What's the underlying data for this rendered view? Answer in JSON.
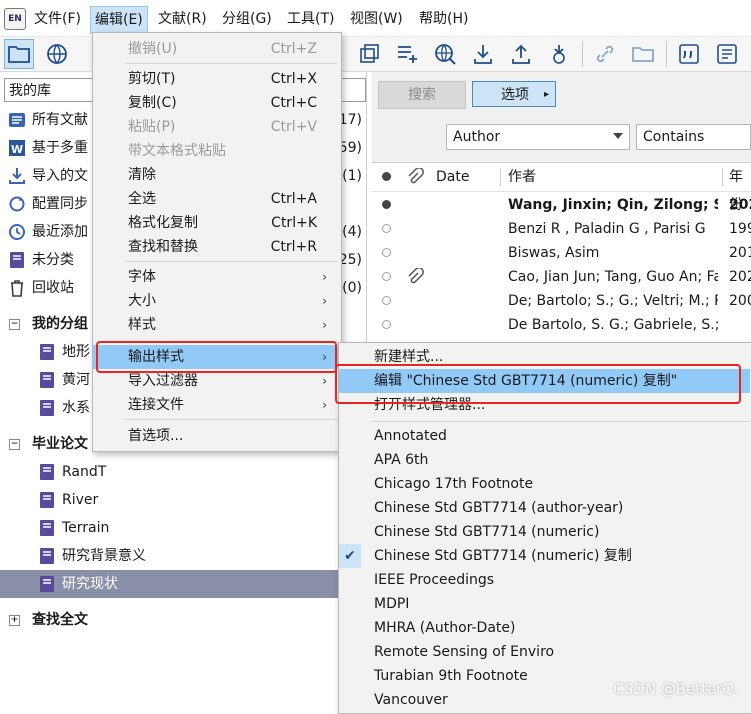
{
  "app": {
    "logo": "EN"
  },
  "menubar": [
    "文件(F)",
    "编辑(E)",
    "文献(R)",
    "分组(G)",
    "工具(T)",
    "视图(W)",
    "帮助(H)"
  ],
  "left": {
    "library_label": "我的库",
    "items": [
      {
        "label": "所有文献",
        "count": "17)",
        "icon": "all-refs-icon"
      },
      {
        "label": "基于多重",
        "count": "59)",
        "icon": "word-doc-icon"
      },
      {
        "label": "导入的文",
        "count": "(1)",
        "icon": "import-icon"
      },
      {
        "label": "配置同步",
        "count": "",
        "icon": "sync-icon"
      },
      {
        "label": "最近添加",
        "count": "(4)",
        "icon": "recent-icon"
      },
      {
        "label": "未分类",
        "count": "25)",
        "icon": "group-icon"
      },
      {
        "label": "回收站",
        "count": "(0)",
        "icon": "trash-icon"
      }
    ],
    "group_sets": [
      {
        "label": "我的分组",
        "groups": [
          "地形",
          "黄河",
          "水系"
        ]
      },
      {
        "label": "毕业论文",
        "groups": [
          "RandT",
          "River",
          "Terrain",
          "研究背景意义",
          "研究现状"
        ]
      }
    ],
    "find_fulltext": "查找全文"
  },
  "right": {
    "search_btn": "搜索",
    "options_btn": "选项",
    "field_select": "Author",
    "op_select": "Contains",
    "col_date": "Date",
    "col_author": "作者",
    "col_year": "年份",
    "rows": [
      {
        "author": "Wang, Jinxin; Qin, Zilong; S...",
        "year": "202",
        "bold": true,
        "filled": true,
        "clip": false
      },
      {
        "author": "Benzi R , Paladin G , Parisi G",
        "year": "199",
        "bold": false,
        "filled": false,
        "clip": false
      },
      {
        "author": "Biswas, Asim",
        "year": "201",
        "bold": false,
        "filled": false,
        "clip": false
      },
      {
        "author": "Cao, Jian Jun; Tang, Guo An; Fa...",
        "year": "202",
        "bold": false,
        "filled": false,
        "clip": true
      },
      {
        "author": "De; Bartolo; S.; G.; Veltri; M.; Pr...",
        "year": "200",
        "bold": false,
        "filled": false,
        "clip": false
      },
      {
        "author": "De Bartolo, S. G.; Gabriele, S.; ...",
        "year": "",
        "bold": false,
        "filled": false,
        "clip": false
      }
    ]
  },
  "edit_menu": {
    "items": [
      {
        "label": "撤销(U)",
        "shortcut": "Ctrl+Z",
        "disabled": true
      },
      {
        "label": "剪切(T)",
        "shortcut": "Ctrl+X",
        "disabled": false
      },
      {
        "label": "复制(C)",
        "shortcut": "Ctrl+C",
        "disabled": false
      },
      {
        "label": "粘贴(P)",
        "shortcut": "Ctrl+V",
        "disabled": true
      },
      {
        "label": "带文本格式粘贴",
        "shortcut": "",
        "disabled": true
      },
      {
        "label": "清除",
        "shortcut": "",
        "disabled": false
      },
      {
        "label": "全选",
        "shortcut": "Ctrl+A",
        "disabled": false
      },
      {
        "label": "格式化复制",
        "shortcut": "Ctrl+K",
        "disabled": false
      },
      {
        "label": "查找和替换",
        "shortcut": "Ctrl+R",
        "disabled": false
      },
      {
        "label": "字体",
        "submenu": true
      },
      {
        "label": "大小",
        "submenu": true
      },
      {
        "label": "样式",
        "submenu": true
      },
      {
        "label": "输出样式",
        "submenu": true,
        "highlighted": true
      },
      {
        "label": "导入过滤器",
        "submenu": true
      },
      {
        "label": "连接文件",
        "submenu": true
      },
      {
        "label": "首选项..."
      }
    ]
  },
  "style_menu": {
    "top_items": [
      "新建样式...",
      "编辑 \"Chinese Std GBT7714 (numeric) 复制\"",
      "打开样式管理器..."
    ],
    "styles": [
      "Annotated",
      "APA 6th",
      "Chicago 17th Footnote",
      "Chinese Std GBT7714 (author-year)",
      "Chinese Std GBT7714 (numeric)",
      "Chinese Std GBT7714 (numeric) 复制",
      "IEEE Proceedings",
      "MDPI",
      "MHRA (Author-Date)",
      "Remote Sensing of Enviro",
      "Turabian 9th Footnote",
      "Vancouver"
    ],
    "checked_index": 5
  },
  "watermark": "CSDN @BetterQ.",
  "colors": {
    "highlight": "#91c9f7",
    "annotation_red": "#e8251f",
    "selected_group": "#8a8fa8"
  }
}
